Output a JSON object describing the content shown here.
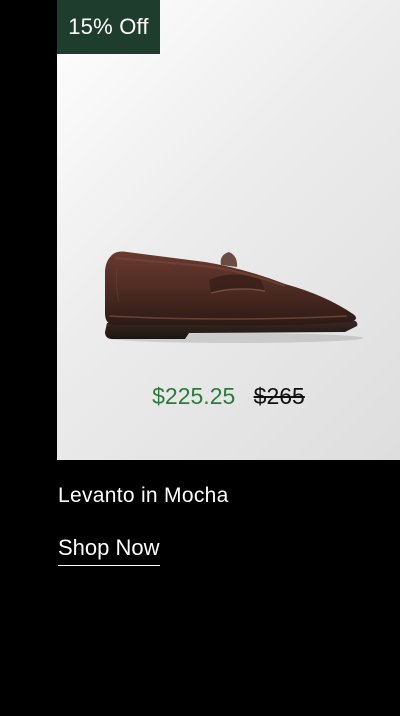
{
  "product": {
    "badge": "15% Off",
    "name": "Levanto in Mocha",
    "sale_price": "$225.25",
    "original_price": "$265",
    "image_icon": "loafer-shoe-image",
    "colors": {
      "badge_background": "#1f3d2c",
      "sale_price": "#2c7a3e",
      "shoe_leather": "#4a2a22"
    }
  },
  "cta": {
    "label": "Shop Now"
  }
}
